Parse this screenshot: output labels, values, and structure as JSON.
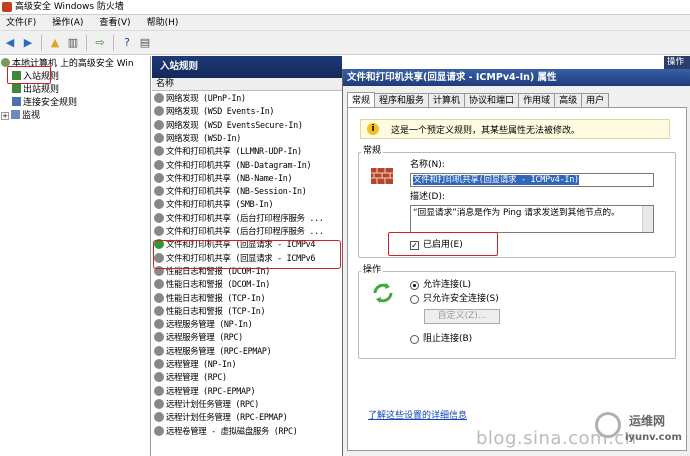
{
  "window": {
    "title": "高级安全 Windows 防火墙"
  },
  "menu": [
    "文件(F)",
    "操作(A)",
    "查看(V)",
    "帮助(H)"
  ],
  "tree": {
    "root": "本地计算机 上的高级安全 Win",
    "items": [
      "入站规则",
      "出站规则",
      "连接安全规则",
      "监视"
    ]
  },
  "center": {
    "header": "入站规则",
    "column": "名称",
    "rows": [
      {
        "label": "网络发现 (UPnP-In)",
        "enabled": false
      },
      {
        "label": "网络发现 (WSD Events-In)",
        "enabled": false
      },
      {
        "label": "网络发现 (WSD EventsSecure-In)",
        "enabled": false
      },
      {
        "label": "网络发现 (WSD-In)",
        "enabled": false
      },
      {
        "label": "文件和打印机共享 (LLMNR-UDP-In)",
        "enabled": false
      },
      {
        "label": "文件和打印机共享 (NB-Datagram-In)",
        "enabled": false
      },
      {
        "label": "文件和打印机共享 (NB-Name-In)",
        "enabled": false
      },
      {
        "label": "文件和打印机共享 (NB-Session-In)",
        "enabled": false
      },
      {
        "label": "文件和打印机共享 (SMB-In)",
        "enabled": false
      },
      {
        "label": "文件和打印机共享 (后台打印程序服务 ...",
        "enabled": false
      },
      {
        "label": "文件和打印机共享 (后台打印程序服务 ...",
        "enabled": false
      },
      {
        "label": "文件和打印机共享 (回显请求 - ICMPv4",
        "enabled": true
      },
      {
        "label": "文件和打印机共享 (回显请求 - ICMPv6",
        "enabled": false
      },
      {
        "label": "性能日志和警报 (DCOM-In)",
        "enabled": false
      },
      {
        "label": "性能日志和警报 (DCOM-In)",
        "enabled": false
      },
      {
        "label": "性能日志和警报 (TCP-In)",
        "enabled": false
      },
      {
        "label": "性能日志和警报 (TCP-In)",
        "enabled": false
      },
      {
        "label": "远程服务管理 (NP-In)",
        "enabled": false
      },
      {
        "label": "远程服务管理 (RPC)",
        "enabled": false
      },
      {
        "label": "远程服务管理 (RPC-EPMAP)",
        "enabled": false
      },
      {
        "label": "远程管理 (NP-In)",
        "enabled": false
      },
      {
        "label": "远程管理 (RPC)",
        "enabled": false
      },
      {
        "label": "远程管理 (RPC-EPMAP)",
        "enabled": false
      },
      {
        "label": "远程计划任务管理 (RPC)",
        "enabled": false
      },
      {
        "label": "远程计划任务管理 (RPC-EPMAP)",
        "enabled": false
      },
      {
        "label": "远程卷管理 - 虚拟磁盘服务 (RPC)",
        "enabled": false
      }
    ]
  },
  "actions_label": "操作",
  "dialog": {
    "title": "文件和打印机共享(回显请求 - ICMPv4-In) 属性",
    "tabs": [
      "常规",
      "程序和服务",
      "计算机",
      "协议和端口",
      "作用域",
      "高级",
      "用户"
    ],
    "info": "这是一个预定义规则，其某些属性无法被修改。",
    "general_group": "常规",
    "name_label": "名称(N):",
    "name_value": "文件和打印机共享(回显请求 - ICMPv4-In)",
    "desc_label": "描述(D):",
    "desc_value": "“回显请求”消息是作为 Ping 请求发送到其他节点的。",
    "enabled_label": "已启用(E)",
    "enabled": true,
    "action_group": "操作",
    "allow": "允许连接(L)",
    "allow_secure": "只允许安全连接(S)",
    "customize": "自定义(Z)...",
    "block": "阻止连接(B)",
    "link": "了解这些设置的详细信息"
  },
  "watermark": {
    "text": "blog.sina.com.cn",
    "logo_top": "运维网",
    "logo_bottom": "iyunv.com"
  }
}
